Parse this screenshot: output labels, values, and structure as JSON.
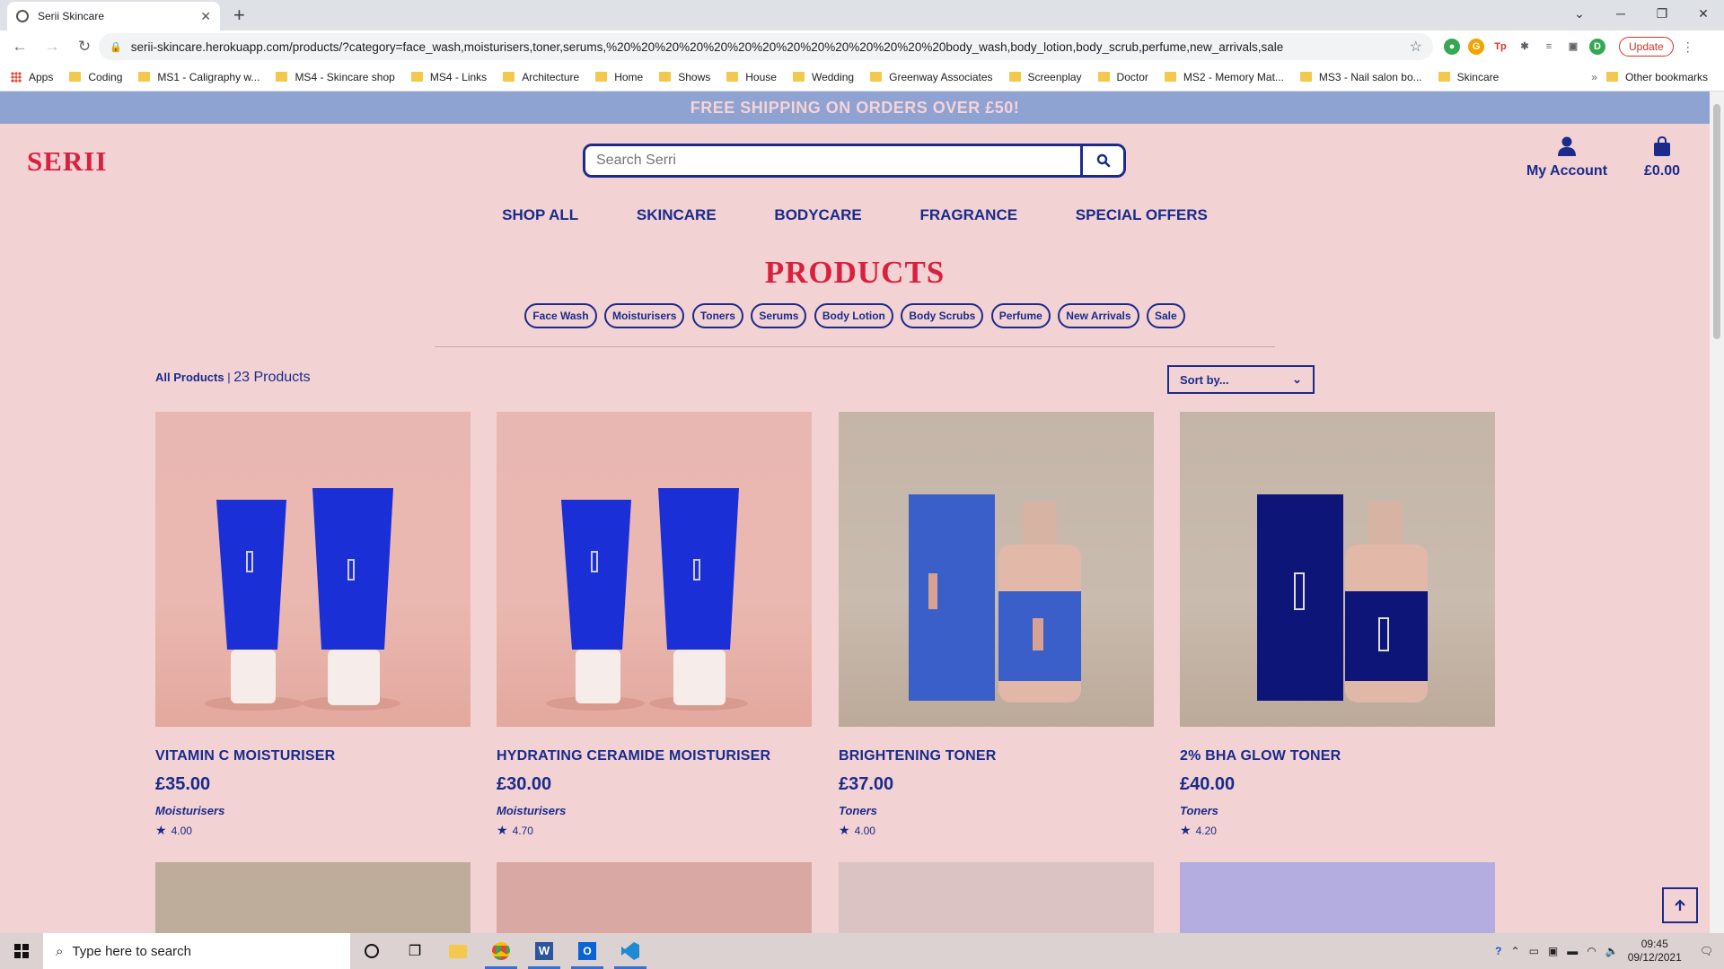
{
  "browser": {
    "tab_title": "Serii Skincare",
    "url": "serii-skincare.herokuapp.com/products/?category=face_wash,moisturisers,toner,serums,%20%20%20%20%20%20%20%20%20%20%20%20%20%20body_wash,body_lotion,body_scrub,perfume,new_arrivals,sale",
    "update_label": "Update",
    "profile_initial": "D",
    "bookmarks": [
      "Coding",
      "MS1 - Caligraphy w...",
      "MS4 - Skincare shop",
      "MS4 - Links",
      "Architecture",
      "Home",
      "Shows",
      "House",
      "Wedding",
      "Greenway Associates",
      "Screenplay",
      "Doctor",
      "MS2 - Memory Mat...",
      "MS3 - Nail salon bo...",
      "Skincare"
    ],
    "apps_label": "Apps",
    "other_bookmarks": "Other bookmarks"
  },
  "site": {
    "banner": "FREE SHIPPING ON ORDERS OVER £50!",
    "logo": "SERII",
    "search_placeholder": "Search Serri",
    "account_label": "My Account",
    "bag_total": "£0.00",
    "nav": [
      "SHOP ALL",
      "SKINCARE",
      "BODYCARE",
      "FRAGRANCE",
      "SPECIAL OFFERS"
    ],
    "page_title": "PRODUCTS",
    "categories": [
      "Face Wash",
      "Moisturisers",
      "Toners",
      "Serums",
      "Body Lotion",
      "Body Scrubs",
      "Perfume",
      "New Arrivals",
      "Sale"
    ],
    "all_products_label": "All Products",
    "separator": "|",
    "product_count": "23 Products",
    "sort_label": "Sort by...",
    "products": [
      {
        "name": "VITAMIN C MOISTURISER",
        "price": "£35.00",
        "category": "Moisturisers",
        "rating": "4.00"
      },
      {
        "name": "HYDRATING CERAMIDE MOISTURISER",
        "price": "£30.00",
        "category": "Moisturisers",
        "rating": "4.70"
      },
      {
        "name": "BRIGHTENING TONER",
        "price": "£37.00",
        "category": "Toners",
        "rating": "4.00"
      },
      {
        "name": "2% BHA GLOW TONER",
        "price": "£40.00",
        "category": "Toners",
        "rating": "4.20"
      }
    ]
  },
  "taskbar": {
    "search_placeholder": "Type here to search",
    "time": "09:45",
    "date": "09/12/2021"
  },
  "colors": {
    "page_bg": "#f2d2d3",
    "brand_red": "#d9203f",
    "navy": "#1a2b8c",
    "banner_bg": "#8fa3d2"
  }
}
